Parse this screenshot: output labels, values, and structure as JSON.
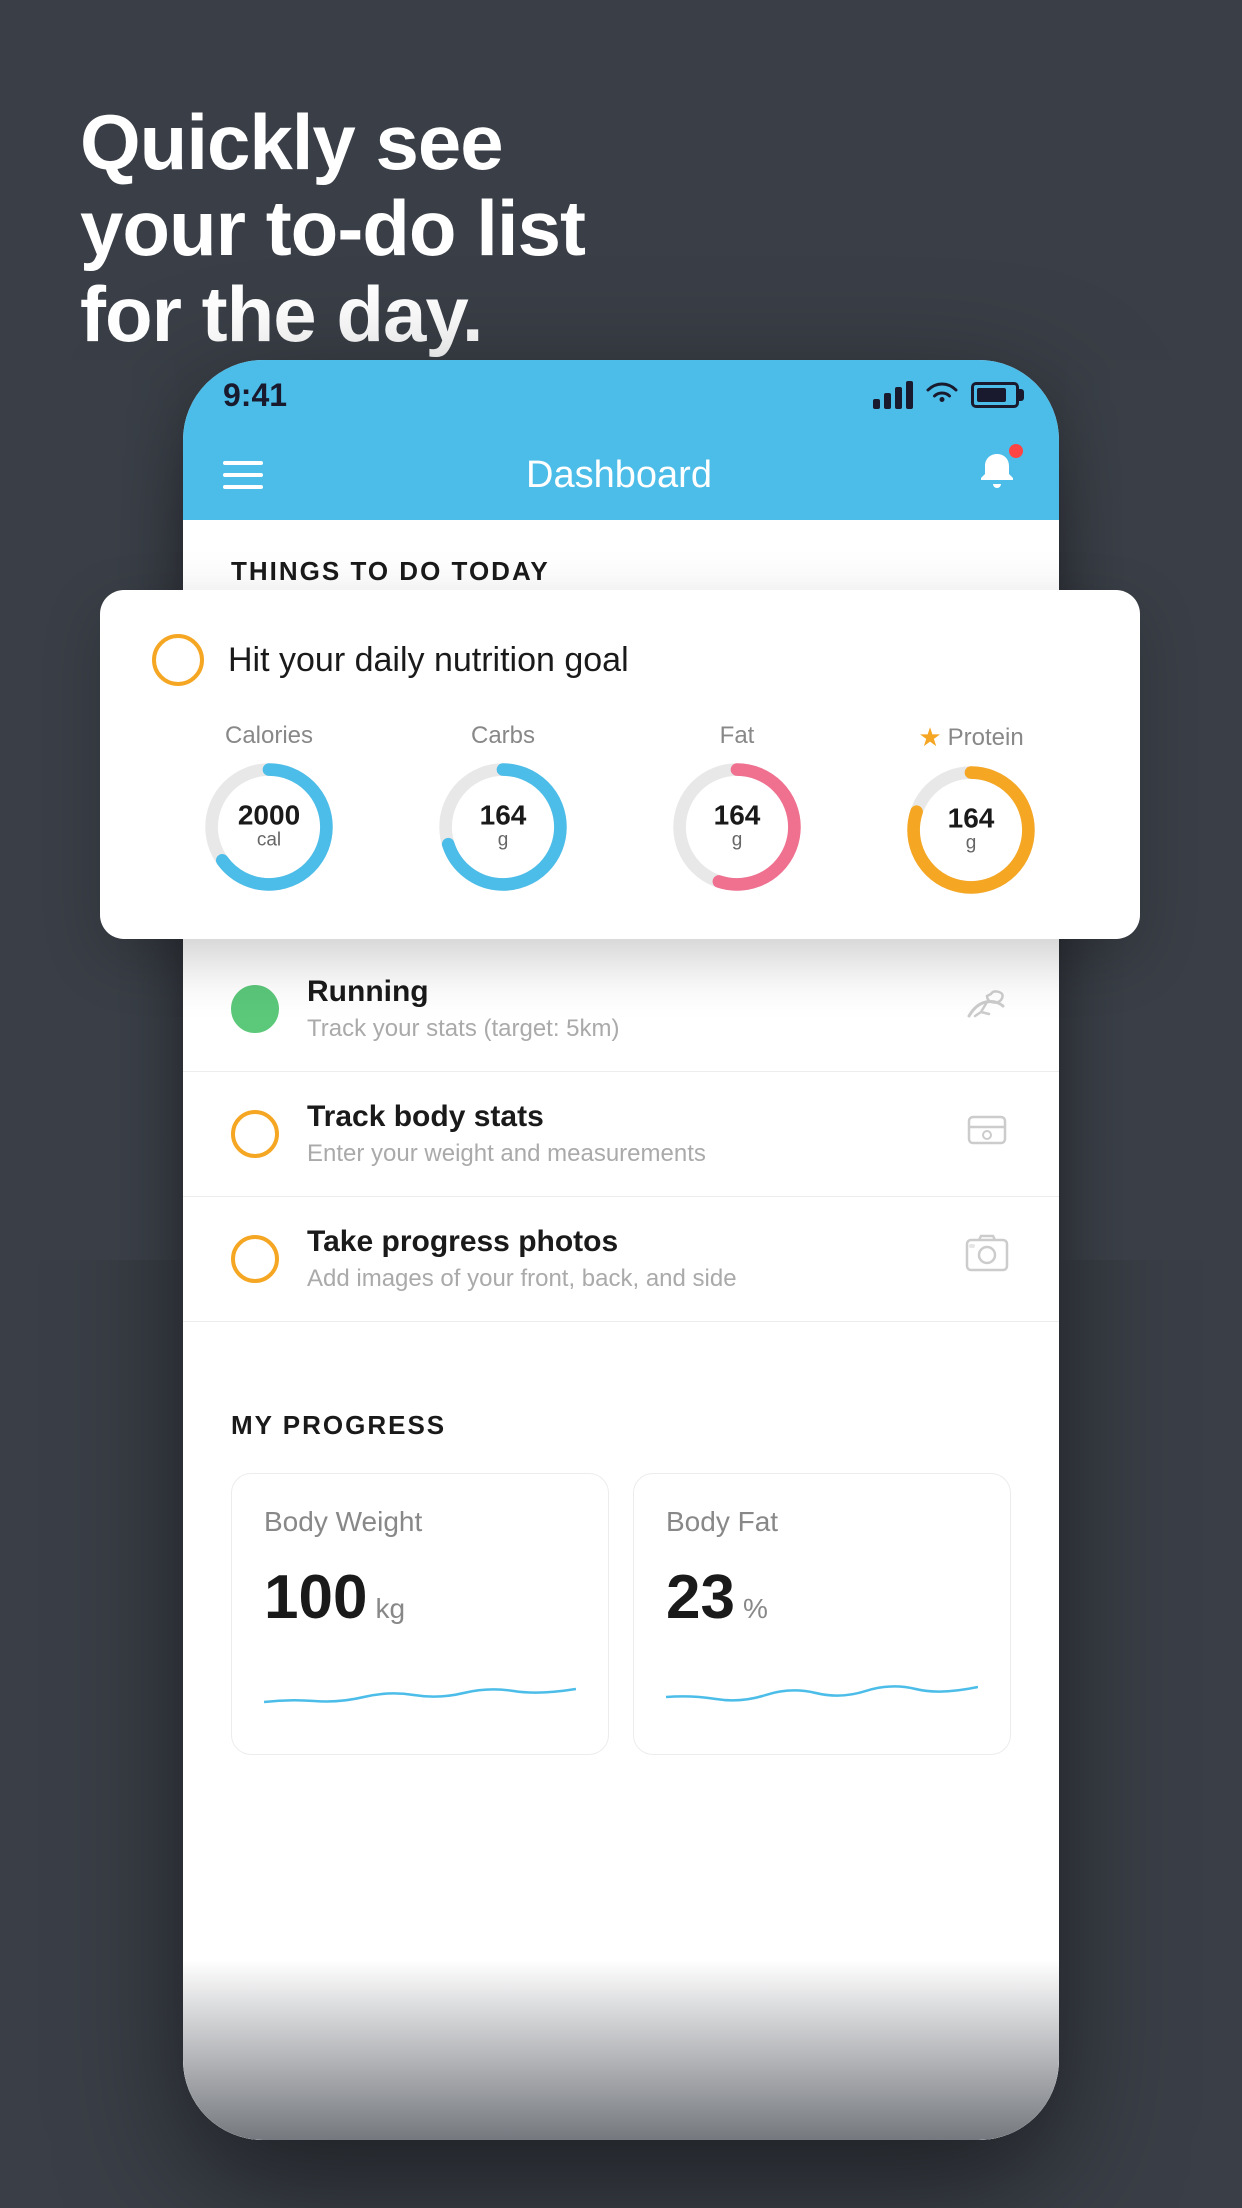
{
  "headline": {
    "line1": "Quickly see",
    "line2": "your to-do list",
    "line3": "for the day."
  },
  "status_bar": {
    "time": "9:41"
  },
  "nav": {
    "title": "Dashboard"
  },
  "things_today": {
    "header": "THINGS TO DO TODAY"
  },
  "nutrition_card": {
    "title": "Hit your daily nutrition goal",
    "items": [
      {
        "label": "Calories",
        "value": "2000",
        "unit": "cal",
        "color": "#4bbde8",
        "percent": 65
      },
      {
        "label": "Carbs",
        "value": "164",
        "unit": "g",
        "color": "#4bbde8",
        "percent": 70
      },
      {
        "label": "Fat",
        "value": "164",
        "unit": "g",
        "color": "#f07090",
        "percent": 55
      },
      {
        "label": "Protein",
        "value": "164",
        "unit": "g",
        "color": "#f5a623",
        "is_star": true,
        "percent": 80
      }
    ]
  },
  "todo_items": [
    {
      "title": "Running",
      "subtitle": "Track your stats (target: 5km)",
      "status": "complete",
      "icon": "shoe"
    },
    {
      "title": "Track body stats",
      "subtitle": "Enter your weight and measurements",
      "status": "incomplete",
      "icon": "scale"
    },
    {
      "title": "Take progress photos",
      "subtitle": "Add images of your front, back, and side",
      "status": "incomplete",
      "icon": "photo"
    }
  ],
  "progress": {
    "header": "MY PROGRESS",
    "cards": [
      {
        "title": "Body Weight",
        "value": "100",
        "unit": "kg"
      },
      {
        "title": "Body Fat",
        "value": "23",
        "unit": "%"
      }
    ]
  }
}
